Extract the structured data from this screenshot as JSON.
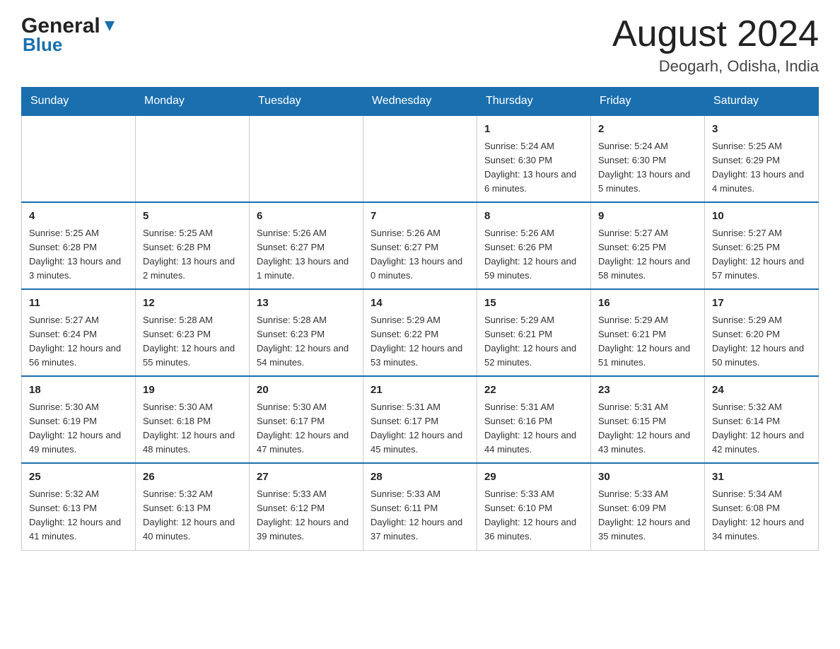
{
  "header": {
    "logo": {
      "general": "General",
      "blue": "Blue"
    },
    "title": "August 2024",
    "location": "Deogarh, Odisha, India"
  },
  "weekdays": [
    "Sunday",
    "Monday",
    "Tuesday",
    "Wednesday",
    "Thursday",
    "Friday",
    "Saturday"
  ],
  "weeks": [
    [
      {
        "day": "",
        "info": ""
      },
      {
        "day": "",
        "info": ""
      },
      {
        "day": "",
        "info": ""
      },
      {
        "day": "",
        "info": ""
      },
      {
        "day": "1",
        "info": "Sunrise: 5:24 AM\nSunset: 6:30 PM\nDaylight: 13 hours and 6 minutes."
      },
      {
        "day": "2",
        "info": "Sunrise: 5:24 AM\nSunset: 6:30 PM\nDaylight: 13 hours and 5 minutes."
      },
      {
        "day": "3",
        "info": "Sunrise: 5:25 AM\nSunset: 6:29 PM\nDaylight: 13 hours and 4 minutes."
      }
    ],
    [
      {
        "day": "4",
        "info": "Sunrise: 5:25 AM\nSunset: 6:28 PM\nDaylight: 13 hours and 3 minutes."
      },
      {
        "day": "5",
        "info": "Sunrise: 5:25 AM\nSunset: 6:28 PM\nDaylight: 13 hours and 2 minutes."
      },
      {
        "day": "6",
        "info": "Sunrise: 5:26 AM\nSunset: 6:27 PM\nDaylight: 13 hours and 1 minute."
      },
      {
        "day": "7",
        "info": "Sunrise: 5:26 AM\nSunset: 6:27 PM\nDaylight: 13 hours and 0 minutes."
      },
      {
        "day": "8",
        "info": "Sunrise: 5:26 AM\nSunset: 6:26 PM\nDaylight: 12 hours and 59 minutes."
      },
      {
        "day": "9",
        "info": "Sunrise: 5:27 AM\nSunset: 6:25 PM\nDaylight: 12 hours and 58 minutes."
      },
      {
        "day": "10",
        "info": "Sunrise: 5:27 AM\nSunset: 6:25 PM\nDaylight: 12 hours and 57 minutes."
      }
    ],
    [
      {
        "day": "11",
        "info": "Sunrise: 5:27 AM\nSunset: 6:24 PM\nDaylight: 12 hours and 56 minutes."
      },
      {
        "day": "12",
        "info": "Sunrise: 5:28 AM\nSunset: 6:23 PM\nDaylight: 12 hours and 55 minutes."
      },
      {
        "day": "13",
        "info": "Sunrise: 5:28 AM\nSunset: 6:23 PM\nDaylight: 12 hours and 54 minutes."
      },
      {
        "day": "14",
        "info": "Sunrise: 5:29 AM\nSunset: 6:22 PM\nDaylight: 12 hours and 53 minutes."
      },
      {
        "day": "15",
        "info": "Sunrise: 5:29 AM\nSunset: 6:21 PM\nDaylight: 12 hours and 52 minutes."
      },
      {
        "day": "16",
        "info": "Sunrise: 5:29 AM\nSunset: 6:21 PM\nDaylight: 12 hours and 51 minutes."
      },
      {
        "day": "17",
        "info": "Sunrise: 5:29 AM\nSunset: 6:20 PM\nDaylight: 12 hours and 50 minutes."
      }
    ],
    [
      {
        "day": "18",
        "info": "Sunrise: 5:30 AM\nSunset: 6:19 PM\nDaylight: 12 hours and 49 minutes."
      },
      {
        "day": "19",
        "info": "Sunrise: 5:30 AM\nSunset: 6:18 PM\nDaylight: 12 hours and 48 minutes."
      },
      {
        "day": "20",
        "info": "Sunrise: 5:30 AM\nSunset: 6:17 PM\nDaylight: 12 hours and 47 minutes."
      },
      {
        "day": "21",
        "info": "Sunrise: 5:31 AM\nSunset: 6:17 PM\nDaylight: 12 hours and 45 minutes."
      },
      {
        "day": "22",
        "info": "Sunrise: 5:31 AM\nSunset: 6:16 PM\nDaylight: 12 hours and 44 minutes."
      },
      {
        "day": "23",
        "info": "Sunrise: 5:31 AM\nSunset: 6:15 PM\nDaylight: 12 hours and 43 minutes."
      },
      {
        "day": "24",
        "info": "Sunrise: 5:32 AM\nSunset: 6:14 PM\nDaylight: 12 hours and 42 minutes."
      }
    ],
    [
      {
        "day": "25",
        "info": "Sunrise: 5:32 AM\nSunset: 6:13 PM\nDaylight: 12 hours and 41 minutes."
      },
      {
        "day": "26",
        "info": "Sunrise: 5:32 AM\nSunset: 6:13 PM\nDaylight: 12 hours and 40 minutes."
      },
      {
        "day": "27",
        "info": "Sunrise: 5:33 AM\nSunset: 6:12 PM\nDaylight: 12 hours and 39 minutes."
      },
      {
        "day": "28",
        "info": "Sunrise: 5:33 AM\nSunset: 6:11 PM\nDaylight: 12 hours and 37 minutes."
      },
      {
        "day": "29",
        "info": "Sunrise: 5:33 AM\nSunset: 6:10 PM\nDaylight: 12 hours and 36 minutes."
      },
      {
        "day": "30",
        "info": "Sunrise: 5:33 AM\nSunset: 6:09 PM\nDaylight: 12 hours and 35 minutes."
      },
      {
        "day": "31",
        "info": "Sunrise: 5:34 AM\nSunset: 6:08 PM\nDaylight: 12 hours and 34 minutes."
      }
    ]
  ]
}
